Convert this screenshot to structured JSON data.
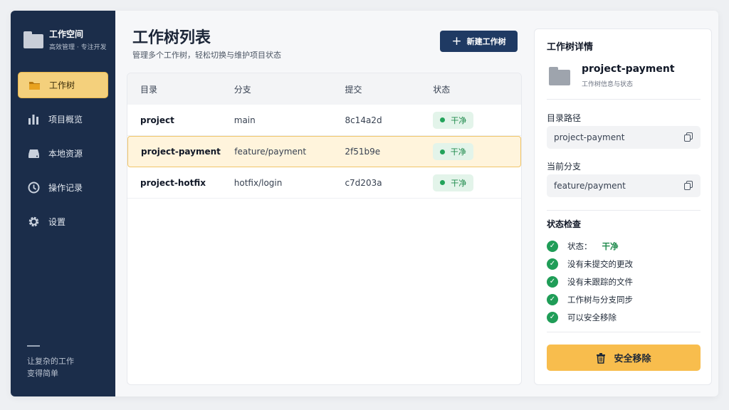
{
  "sidebar": {
    "brand_title": "工作空间",
    "brand_subtitle": "高效管理 · 专注开发",
    "items": [
      {
        "label": "工作树",
        "icon": "folder-icon",
        "active": true
      },
      {
        "label": "项目概览",
        "icon": "bar-chart-icon",
        "active": false
      },
      {
        "label": "本地资源",
        "icon": "drive-icon",
        "active": false
      },
      {
        "label": "操作记录",
        "icon": "clock-icon",
        "active": false
      },
      {
        "label": "设置",
        "icon": "gear-icon",
        "active": false
      }
    ],
    "footer_line1": "让复杂的工作",
    "footer_line2": "变得简单"
  },
  "main": {
    "title": "工作树列表",
    "subtitle": "管理多个工作树，轻松切换与维护项目状态",
    "new_button": "新建工作树",
    "columns": [
      "目录",
      "分支",
      "提交",
      "状态"
    ],
    "rows": [
      {
        "dir": "project",
        "branch": "main",
        "commit": "8c14a2d",
        "status": "干净",
        "selected": false
      },
      {
        "dir": "project-payment",
        "branch": "feature/payment",
        "commit": "2f51b9e",
        "status": "干净",
        "selected": true
      },
      {
        "dir": "project-hotfix",
        "branch": "hotfix/login",
        "commit": "c7d203a",
        "status": "干净",
        "selected": false
      }
    ]
  },
  "detail": {
    "title": "工作树详情",
    "name": "project-payment",
    "name_sub": "工作树信息与状态",
    "path_label": "目录路径",
    "path_value": "project-payment",
    "branch_label": "当前分支",
    "branch_value": "feature/payment",
    "check_title": "状态检查",
    "status_label": "状态：",
    "status_value": "干净",
    "checks": [
      "没有未提交的更改",
      "没有未跟踪的文件",
      "工作树与分支同步",
      "可以安全移除"
    ],
    "remove_button": "安全移除"
  },
  "colors": {
    "sidebar_bg": "#1b2d4a",
    "accent": "#f4d07c",
    "primary_button": "#1f3a63",
    "success": "#1f9d57",
    "danger_button": "#f8bd4d"
  }
}
